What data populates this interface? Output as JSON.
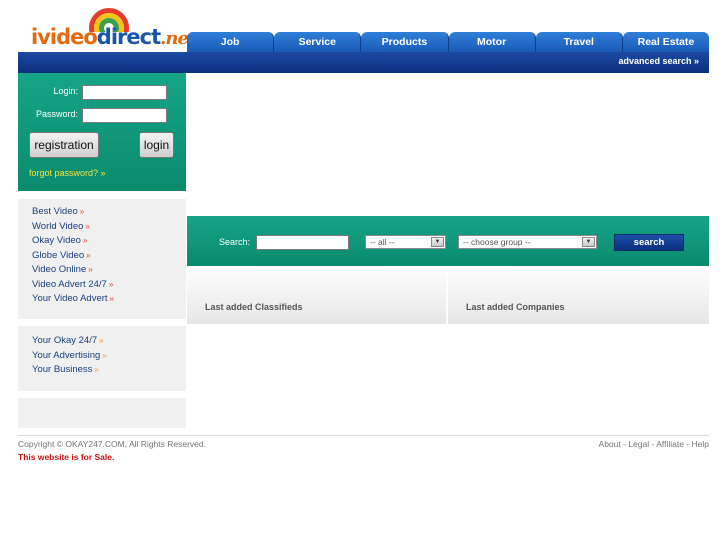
{
  "logo": {
    "part1": "ivideo",
    "part2": "direct",
    "part3": ".net"
  },
  "nav": {
    "tabs": [
      "Job",
      "Service",
      "Products",
      "Motor",
      "Travel",
      "Real Estate"
    ],
    "advanced_search": "advanced search »"
  },
  "login": {
    "login_label": "Login:",
    "password_label": "Password:",
    "login_value": "",
    "password_value": "",
    "registration_button": "registration",
    "login_button": "login",
    "forgot_password": "forgot password? »"
  },
  "left_menu": {
    "group1": [
      "Best Video",
      "World Video",
      "Okay Video",
      "Globe Video",
      "Video Online",
      "Video Advert 24/7",
      "Your Video Advert"
    ],
    "group2": [
      "Your Okay 24/7",
      "Your Advertising",
      "Your Business"
    ],
    "arrow": "»"
  },
  "search": {
    "label": "Search:",
    "value": "",
    "select_all": "-- all --",
    "select_group": "-- choose group --",
    "button": "search"
  },
  "sections": {
    "last_classifieds": "Last added Classifieds",
    "last_companies": "Last added Companies"
  },
  "footer": {
    "copyright": "Copyright © OKAY247.COM, All Rights Reserved.",
    "for_sale": "This website is for Sale.",
    "links": [
      "About",
      "Legal",
      "Affiliate",
      "Help"
    ],
    "separator": " - "
  }
}
